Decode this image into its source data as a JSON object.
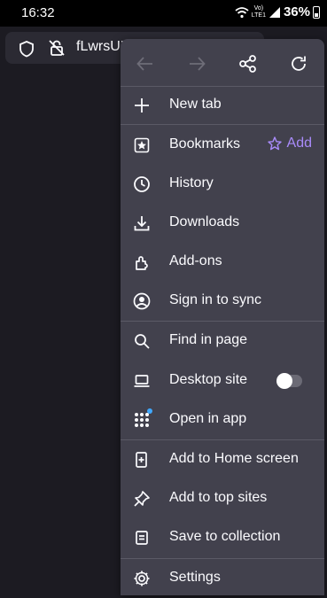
{
  "status": {
    "time": "16:32",
    "network_line1": "Vo)",
    "network_line2": "LTE1",
    "battery": "36%"
  },
  "url": {
    "text": "fLwrsUL"
  },
  "menu": {
    "items": [
      {
        "label": "New tab"
      },
      {
        "label": "Bookmarks",
        "add_label": "Add"
      },
      {
        "label": "History"
      },
      {
        "label": "Downloads"
      },
      {
        "label": "Add-ons"
      },
      {
        "label": "Sign in to sync"
      },
      {
        "label": "Find in page"
      },
      {
        "label": "Desktop site",
        "toggle_on": false
      },
      {
        "label": "Open in app"
      },
      {
        "label": "Add to Home screen"
      },
      {
        "label": "Add to top sites"
      },
      {
        "label": "Save to collection"
      },
      {
        "label": "Settings"
      }
    ]
  },
  "colors": {
    "accent": "#a98bfa",
    "menu_bg": "#42414d",
    "page_bg": "#1c1b22",
    "badge": "#40a8ff"
  }
}
